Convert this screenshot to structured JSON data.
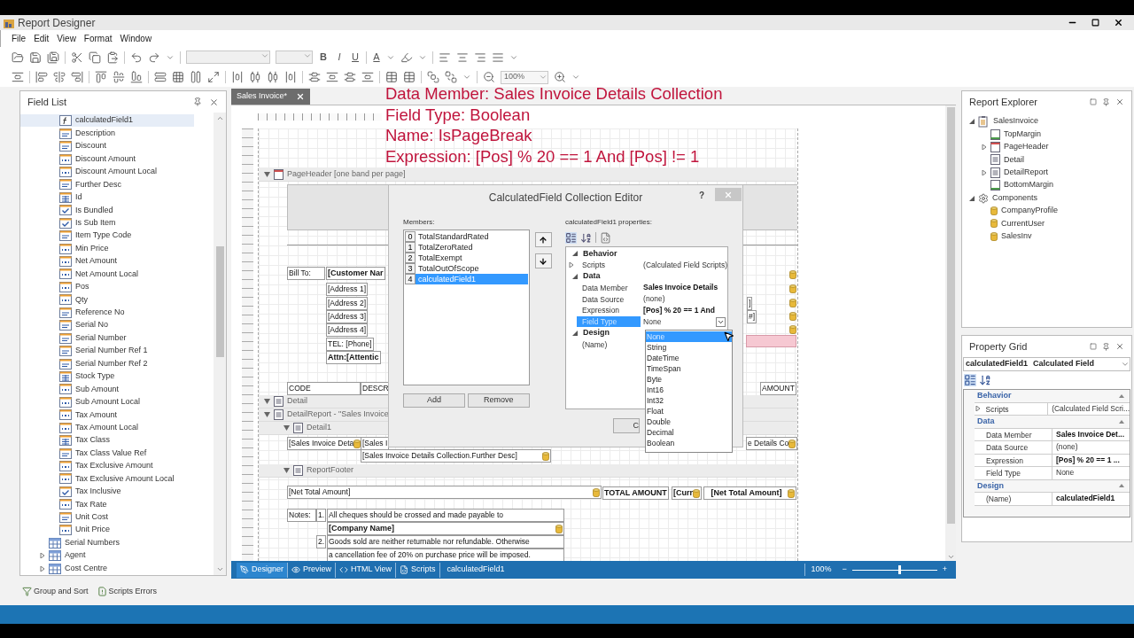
{
  "window": {
    "title": "Report Designer"
  },
  "menu": [
    "File",
    "Edit",
    "View",
    "Format",
    "Window"
  ],
  "toolbar": {
    "font_style_buttons": [
      "B",
      "I",
      "U"
    ],
    "font_color_button": "A",
    "zoom": "100%"
  },
  "annotation": [
    "Data Member: Sales Invoice Details Collection",
    "Field Type: Boolean",
    "Name: IsPageBreak",
    "Expression: [Pos] % 20 == 1 And [Pos] != 1"
  ],
  "field_list": {
    "title": "Field List",
    "fields": [
      {
        "label": "calculatedField1",
        "kind": "calculated",
        "selected": true
      },
      {
        "label": "Description",
        "kind": "text",
        "selected": false
      },
      {
        "label": "Discount",
        "kind": "text",
        "selected": false
      },
      {
        "label": "Discount Amount",
        "kind": "number",
        "selected": false
      },
      {
        "label": "Discount Amount Local",
        "kind": "number",
        "selected": false
      },
      {
        "label": "Further Desc",
        "kind": "text",
        "selected": false
      },
      {
        "label": "Id",
        "kind": "enum",
        "selected": false
      },
      {
        "label": "Is Bundled",
        "kind": "bool",
        "selected": false
      },
      {
        "label": "Is Sub Item",
        "kind": "bool",
        "selected": false
      },
      {
        "label": "Item Type Code",
        "kind": "text",
        "selected": false
      },
      {
        "label": "Min Price",
        "kind": "number",
        "selected": false
      },
      {
        "label": "Net Amount",
        "kind": "number",
        "selected": false
      },
      {
        "label": "Net Amount Local",
        "kind": "number",
        "selected": false
      },
      {
        "label": "Pos",
        "kind": "number",
        "selected": false
      },
      {
        "label": "Qty",
        "kind": "number",
        "selected": false
      },
      {
        "label": "Reference No",
        "kind": "text",
        "selected": false
      },
      {
        "label": "Serial No",
        "kind": "text",
        "selected": false
      },
      {
        "label": "Serial Number",
        "kind": "text",
        "selected": false
      },
      {
        "label": "Serial Number Ref 1",
        "kind": "text",
        "selected": false
      },
      {
        "label": "Serial Number Ref 2",
        "kind": "text",
        "selected": false
      },
      {
        "label": "Stock Type",
        "kind": "enum",
        "selected": false
      },
      {
        "label": "Sub Amount",
        "kind": "number",
        "selected": false
      },
      {
        "label": "Sub Amount Local",
        "kind": "number",
        "selected": false
      },
      {
        "label": "Tax Amount",
        "kind": "number",
        "selected": false
      },
      {
        "label": "Tax Amount Local",
        "kind": "number",
        "selected": false
      },
      {
        "label": "Tax Class",
        "kind": "enum",
        "selected": false
      },
      {
        "label": "Tax Class Value Ref",
        "kind": "text",
        "selected": false
      },
      {
        "label": "Tax Exclusive Amount",
        "kind": "number",
        "selected": false
      },
      {
        "label": "Tax Exclusive Amount Local",
        "kind": "number",
        "selected": false
      },
      {
        "label": "Tax Inclusive",
        "kind": "bool",
        "selected": false
      },
      {
        "label": "Tax Rate",
        "kind": "number",
        "selected": false
      },
      {
        "label": "Unit Cost",
        "kind": "text",
        "selected": false
      },
      {
        "label": "Unit Price",
        "kind": "number",
        "selected": false
      }
    ],
    "tables": [
      {
        "label": "Serial Numbers",
        "expandable": false
      },
      {
        "label": "Agent",
        "expandable": true
      },
      {
        "label": "Cost Centre",
        "expandable": true
      }
    ]
  },
  "bottom_tabs": [
    "Group and Sort",
    "Scripts Errors"
  ],
  "designer": {
    "tabs": [
      {
        "label": "Sales Invoice*",
        "selected": true
      }
    ],
    "bands": [
      {
        "label": "PageHeader [one band per page]",
        "expanded": true,
        "controls": [
          {
            "text": "Bill To:",
            "bold": false,
            "bound": false
          },
          {
            "text": "[Customer Nar",
            "bold": true,
            "bound": false
          },
          {
            "text": "[Address 1]",
            "bold": false,
            "bound": false
          },
          {
            "text": "[Address 2]",
            "bold": false,
            "bound": false
          },
          {
            "text": "[Address 3]",
            "bold": false,
            "bound": false
          },
          {
            "text": "[Address 4]",
            "bold": false,
            "bound": false
          },
          {
            "text": "TEL: [Phone]",
            "bold": false,
            "bound": false
          },
          {
            "text": "Attn:[Attentic",
            "bold": true,
            "bound": false
          },
          {
            "text": "CODE",
            "bold": false,
            "bound": false
          },
          {
            "text": "DESCR",
            "bold": false,
            "bound": false
          },
          {
            "text": "]",
            "bold": false,
            "bound": false
          },
          {
            "text": "#]",
            "bold": false,
            "bound": false
          },
          {
            "text": "AMOUNT",
            "bold": false,
            "bound": false
          }
        ]
      },
      {
        "label": "Detail",
        "expanded": true
      },
      {
        "label": "DetailReport - \"Sales Invoice",
        "expanded": true,
        "children": [
          {
            "label": "Detail1",
            "expanded": true,
            "controls": [
              {
                "text": "[Sales Invoice Deta",
                "bold": false,
                "bound": true
              },
              {
                "text": "[Sales I",
                "bold": false,
                "bound": false
              },
              {
                "text": "e Details Co",
                "bold": false,
                "bound": true
              },
              {
                "text": "[Sales Invoice Details Collection.Further Desc]",
                "bold": false,
                "bound": true
              }
            ]
          },
          {
            "label": "ReportFooter",
            "expanded": true,
            "controls": [
              {
                "text": "[Net Total Amount]",
                "bold": false,
                "bound": true
              },
              {
                "text": "TOTAL AMOUNT",
                "bold": true,
                "bound": false
              },
              {
                "text": "[Curr",
                "bold": true,
                "bound": true
              },
              {
                "text": "[Net Total Amount]",
                "bold": true,
                "bound": true
              },
              {
                "text": "Notes:",
                "bold": false,
                "bound": false
              },
              {
                "text": "1.",
                "bold": false,
                "bound": false
              },
              {
                "text": "All cheques should be crossed and made payable to",
                "bold": false,
                "bound": false
              },
              {
                "text": "[Company Name]",
                "bold": true,
                "bound": true
              },
              {
                "text": "2.",
                "bold": false,
                "bound": false
              },
              {
                "text": "Goods sold are neither returnable nor refundable. Otherwise",
                "bold": false,
                "bound": false
              },
              {
                "text": "a cancellation fee of 20% on purchase price will be imposed.",
                "bold": false,
                "bound": false
              }
            ]
          }
        ]
      }
    ],
    "status_bar": {
      "views": [
        {
          "label": "Designer",
          "selected": true
        },
        {
          "label": "Preview",
          "selected": false
        },
        {
          "label": "HTML View",
          "selected": false
        },
        {
          "label": "Scripts",
          "selected": false
        }
      ],
      "selection": "calculatedField1",
      "zoom": "100%",
      "zoom_out": "−",
      "zoom_in": "+",
      "zoom_slider": {
        "level": 0.55
      }
    }
  },
  "dialog": {
    "title": "CalculatedField Collection Editor",
    "help": "?",
    "members_label": "Members:",
    "members": [
      {
        "index": "0",
        "name": "TotalStandardRated",
        "selected": false
      },
      {
        "index": "1",
        "name": "TotalZeroRated",
        "selected": false
      },
      {
        "index": "2",
        "name": "TotalExempt",
        "selected": false
      },
      {
        "index": "3",
        "name": "TotalOutOfScope",
        "selected": false
      },
      {
        "index": "4",
        "name": "calculatedField1",
        "selected": true
      }
    ],
    "buttons": [
      "Add",
      "Remove"
    ],
    "partial_button": "C",
    "properties_label": "calculatedField1 properties:",
    "categories": [
      {
        "label": "Behavior",
        "rows": [
          {
            "name": "Scripts",
            "value": "(Calculated Field Scripts)",
            "bold": false,
            "expandable": true,
            "selected": false
          }
        ]
      },
      {
        "label": "Data",
        "rows": [
          {
            "name": "Data Member",
            "value": "Sales Invoice Details",
            "bold": true,
            "expandable": false,
            "selected": false
          },
          {
            "name": "Data Source",
            "value": "(none)",
            "bold": false,
            "expandable": false,
            "selected": false
          },
          {
            "name": "Expression",
            "value": "[Pos] % 20 == 1 And",
            "bold": true,
            "expandable": false,
            "selected": false
          },
          {
            "name": "Field Type",
            "value": "None",
            "bold": false,
            "expandable": false,
            "selected": true
          }
        ]
      },
      {
        "label": "Design",
        "rows": [
          {
            "name": "(Name)",
            "expandable": false,
            "selected": false
          }
        ]
      }
    ],
    "field_type_options": [
      {
        "label": "None",
        "selected": true
      },
      {
        "label": "String",
        "selected": false
      },
      {
        "label": "DateTime",
        "selected": false
      },
      {
        "label": "TimeSpan",
        "selected": false
      },
      {
        "label": "Byte",
        "selected": false
      },
      {
        "label": "Int16",
        "selected": false
      },
      {
        "label": "Int32",
        "selected": false
      },
      {
        "label": "Float",
        "selected": false
      },
      {
        "label": "Double",
        "selected": false
      },
      {
        "label": "Decimal",
        "selected": false
      },
      {
        "label": "Boolean",
        "selected": false
      }
    ]
  },
  "report_explorer": {
    "title": "Report Explorer",
    "tree": [
      {
        "label": "SalesInvoice",
        "kind": "report",
        "expandable": true,
        "expanded": true,
        "children": [
          {
            "label": "TopMargin",
            "kind": "margin",
            "expandable": false,
            "expanded": false
          },
          {
            "label": "PageHeader",
            "kind": "header",
            "expandable": true,
            "expanded": false
          },
          {
            "label": "Detail",
            "kind": "detail",
            "expandable": false,
            "expanded": false
          },
          {
            "label": "DetailReport",
            "kind": "detail",
            "expandable": true,
            "expanded": false
          },
          {
            "label": "BottomMargin",
            "kind": "margin",
            "expandable": false,
            "expanded": false
          }
        ]
      },
      {
        "label": "Components",
        "kind": "components",
        "expandable": true,
        "expanded": true,
        "children": [
          {
            "label": "CompanyProfile",
            "kind": "datasource",
            "expandable": false,
            "expanded": false
          },
          {
            "label": "CurrentUser",
            "kind": "datasource",
            "expandable": false,
            "expanded": false
          },
          {
            "label": "SalesInv",
            "kind": "datasource",
            "expandable": false,
            "expanded": false
          }
        ]
      }
    ]
  },
  "property_grid": {
    "title": "Property Grid",
    "object_name": "calculatedField1",
    "object_type": "Calculated Field",
    "categories": [
      {
        "label": "Behavior",
        "rows": [
          {
            "name": "Scripts",
            "value": "(Calculated Field Scri...",
            "bold": false,
            "expandable": true
          }
        ]
      },
      {
        "label": "Data",
        "rows": [
          {
            "name": "Data Member",
            "value": "Sales Invoice Det...",
            "bold": true,
            "expandable": false
          },
          {
            "name": "Data Source",
            "value": "(none)",
            "bold": false,
            "expandable": false
          },
          {
            "name": "Expression",
            "value": "[Pos] % 20 == 1 ...",
            "bold": true,
            "expandable": false
          },
          {
            "name": "Field Type",
            "value": "None",
            "bold": false,
            "expandable": false
          }
        ]
      },
      {
        "label": "Design",
        "rows": [
          {
            "name": "(Name)",
            "value": "calculatedField1",
            "bold": true,
            "expandable": false
          }
        ]
      }
    ]
  }
}
